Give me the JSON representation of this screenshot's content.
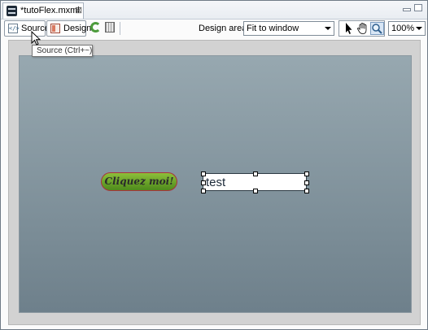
{
  "editor": {
    "tab_title": "*tutoFlex.mxml",
    "tab_close": "⊠"
  },
  "toolbar": {
    "source_label": "Source",
    "design_label": "Design",
    "source_icon_glyph": "</>",
    "design_area_label": "Design area:",
    "design_area_value": "Fit to window",
    "zoom_value": "100%"
  },
  "tooltip": {
    "text": "Source (Ctrl+~)"
  },
  "canvas": {
    "button_label": "Cliquez moi!",
    "textinput_value": "test",
    "background_top": "#97a8b0",
    "background_bottom": "#6e808b",
    "button_color": "#6ea52b",
    "button_border": "#a9323c"
  }
}
